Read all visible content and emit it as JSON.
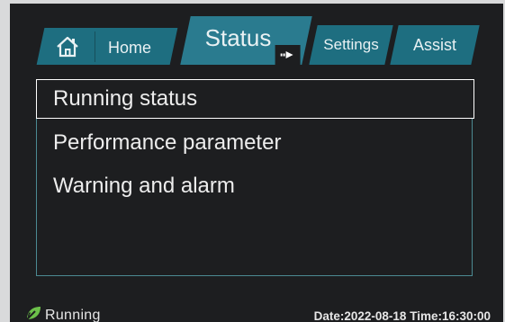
{
  "tabs": {
    "home": {
      "label": "Home",
      "icon": "home-icon"
    },
    "status": {
      "label": "Status",
      "icon": "arrow-right-icon"
    },
    "settings": {
      "label": "Settings"
    },
    "assist": {
      "label": "Assist"
    }
  },
  "menu": {
    "items": [
      {
        "label": "Running status",
        "selected": true
      },
      {
        "label": "Performance parameter",
        "selected": false
      },
      {
        "label": "Warning and alarm",
        "selected": false
      }
    ]
  },
  "status_bar": {
    "state_label": "Running",
    "state_icon": "leaf-icon",
    "datetime": "Date:2022-08-18 Time:16:30:00"
  },
  "colors": {
    "tab": "#1e6e80",
    "background": "#1d1e20",
    "panel_border": "#4c8a92",
    "leaf_green": "#6cc04a"
  }
}
